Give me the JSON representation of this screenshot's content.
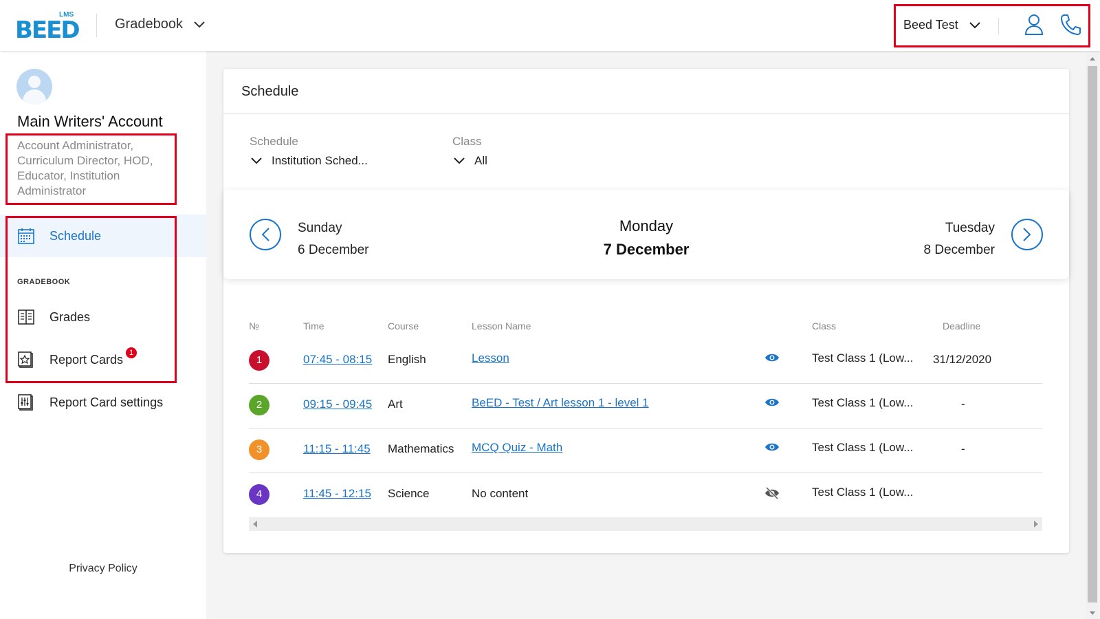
{
  "header": {
    "logo_small": "LMS",
    "logo_word": "BEED",
    "module": "Gradebook",
    "user": "Beed Test",
    "icons": [
      "chevron-down-icon",
      "user-icon",
      "phone-icon"
    ]
  },
  "sidebar": {
    "account_name": "Main Writers' Account",
    "roles": "Account Administrator, Curriculum Director, HOD, Educator, Institution Administrator",
    "items": [
      {
        "label": "Schedule",
        "icon": "calendar-icon",
        "active": true
      },
      {
        "label": "Grades",
        "icon": "book-icon"
      },
      {
        "label": "Report Cards",
        "icon": "report-star-icon",
        "badge": "1"
      },
      {
        "label": "Report Card settings",
        "icon": "report-settings-icon"
      }
    ],
    "section_label": "GRADEBOOK",
    "privacy": "Privacy Policy"
  },
  "schedule": {
    "title": "Schedule",
    "filters": {
      "schedule_label": "Schedule",
      "schedule_value": "Institution Sched...",
      "class_label": "Class",
      "class_value": "All"
    },
    "days": {
      "prev": {
        "weekday": "Sunday",
        "date": "6 December"
      },
      "current": {
        "weekday": "Monday",
        "date": "7 December"
      },
      "next": {
        "weekday": "Tuesday",
        "date": "8 December"
      }
    },
    "columns": {
      "num": "№",
      "time": "Time",
      "course": "Course",
      "lesson": "Lesson Name",
      "class": "Class",
      "deadline": "Deadline"
    },
    "rows": [
      {
        "num": "1",
        "color": "#c8102e",
        "time": "07:45 - 08:15",
        "course": "English",
        "lesson": "Lesson",
        "lesson_link": true,
        "visible": true,
        "class": "Test Class 1 (Low...",
        "deadline": "31/12/2020"
      },
      {
        "num": "2",
        "color": "#5aa52a",
        "time": "09:15 - 09:45",
        "course": "Art",
        "lesson": "BeED - Test / Art lesson 1 - level 1",
        "lesson_link": true,
        "visible": true,
        "class": "Test Class 1 (Low...",
        "deadline": "-"
      },
      {
        "num": "3",
        "color": "#f0912a",
        "time": "11:15 - 11:45",
        "course": "Mathematics",
        "lesson": "MCQ Quiz - Math",
        "lesson_link": true,
        "visible": true,
        "class": "Test Class 1 (Low...",
        "deadline": "-"
      },
      {
        "num": "4",
        "color": "#6a35c2",
        "time": "11:45 - 12:15",
        "course": "Science",
        "lesson": "No content",
        "lesson_link": false,
        "visible": false,
        "class": "Test Class 1 (Low...",
        "deadline": ""
      }
    ]
  },
  "colors": {
    "accent": "#1a74c9",
    "highlight_box": "#e0001b"
  }
}
